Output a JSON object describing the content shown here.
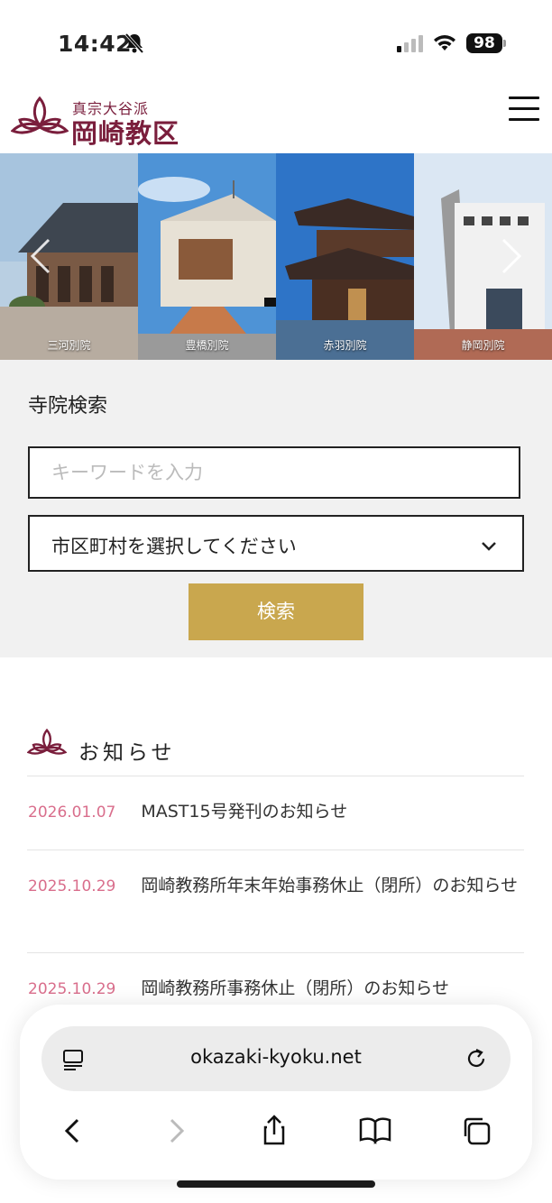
{
  "status_bar": {
    "time": "14:42",
    "battery": "98"
  },
  "header": {
    "logo_sub": "真宗大谷派",
    "logo_main": "岡崎教区",
    "brand_color": "#7a1e3c"
  },
  "slider": {
    "slides": [
      {
        "caption": "三河別院"
      },
      {
        "caption": "豊橋別院"
      },
      {
        "caption": "赤羽別院"
      },
      {
        "caption": "静岡別院"
      }
    ]
  },
  "search": {
    "title": "寺院検索",
    "keyword_placeholder": "キーワードを入力",
    "city_select_value": "市区町村を選択してください",
    "button_label": "検索",
    "button_color": "#c9a74e"
  },
  "news": {
    "title": "お知らせ",
    "date_color": "#d96e8c",
    "items": [
      {
        "date": "2026.01.07",
        "text": "MAST15号発刊のお知らせ"
      },
      {
        "date": "2025.10.29",
        "text": "岡崎教務所年末年始事務休止（閉所）のお知らせ"
      },
      {
        "date": "2025.10.29",
        "text": "岡崎教務所事務休止（閉所）のお知らせ"
      }
    ]
  },
  "browser": {
    "url": "okazaki-kyoku.net"
  }
}
